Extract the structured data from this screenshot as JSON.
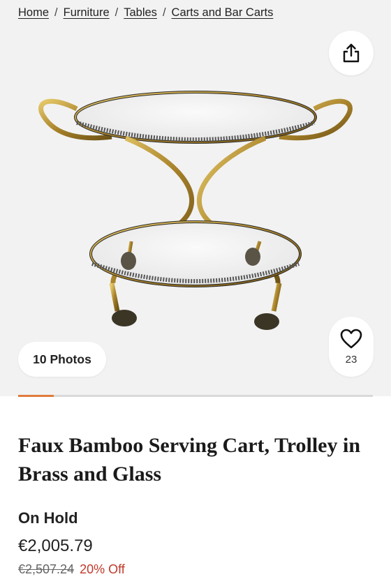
{
  "breadcrumb": {
    "items": [
      "Home",
      "Furniture",
      "Tables",
      "Carts and Bar Carts"
    ],
    "separator": "/"
  },
  "gallery": {
    "photos_label": "10 Photos",
    "favorites_count": "23",
    "current_photo_index": 1,
    "total_photos": 10,
    "progress_fraction": 0.1,
    "accent_color": "#e07b3c",
    "image_alt": "Faux Bamboo Serving Cart, Trolley in Brass and Glass"
  },
  "icons": {
    "share": "share-icon",
    "favorite": "heart-icon"
  },
  "product": {
    "title": "Faux Bamboo Serving Cart, Trolley in Brass and Glass",
    "status": "On Hold",
    "price": "€2,005.79",
    "original_price": "€2,507.24",
    "discount": "20% Off",
    "discount_color": "#c0392b"
  }
}
